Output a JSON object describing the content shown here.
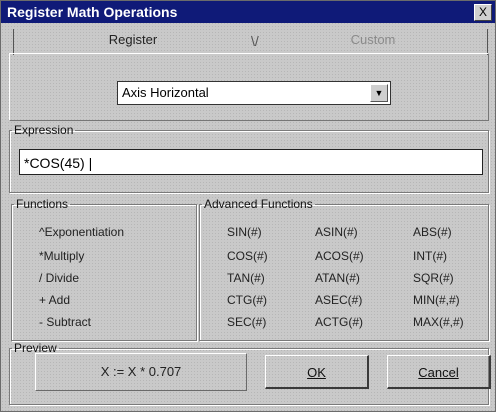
{
  "window": {
    "title": "Register Math Operations",
    "close_label": "X"
  },
  "tabs": [
    {
      "label": "Register"
    },
    {
      "label": "Custom"
    }
  ],
  "tab_separator": "\\/",
  "axis_select": {
    "selected": "Axis Horizontal",
    "arrow": "▼"
  },
  "expression": {
    "legend": "Expression",
    "value": "*COS(45) |"
  },
  "functions": {
    "legend": "Functions",
    "items": [
      "^Exponentiation",
      "*Multiply",
      "/ Divide",
      "+ Add",
      "- Subtract"
    ]
  },
  "advanced": {
    "legend": "Advanced Functions",
    "items": [
      "SIN(#)",
      "ASIN(#)",
      "ABS(#)",
      "COS(#)",
      "ACOS(#)",
      "INT(#)",
      "TAN(#)",
      "ATAN(#)",
      "SQR(#)",
      "CTG(#)",
      "ASEC(#)",
      "MIN(#,#)",
      "SEC(#)",
      "ACTG(#)",
      "MAX(#,#)"
    ]
  },
  "preview": {
    "legend": "Preview",
    "text": "X := X * 0.707"
  },
  "buttons": {
    "ok": "OK",
    "cancel": "Cancel"
  }
}
